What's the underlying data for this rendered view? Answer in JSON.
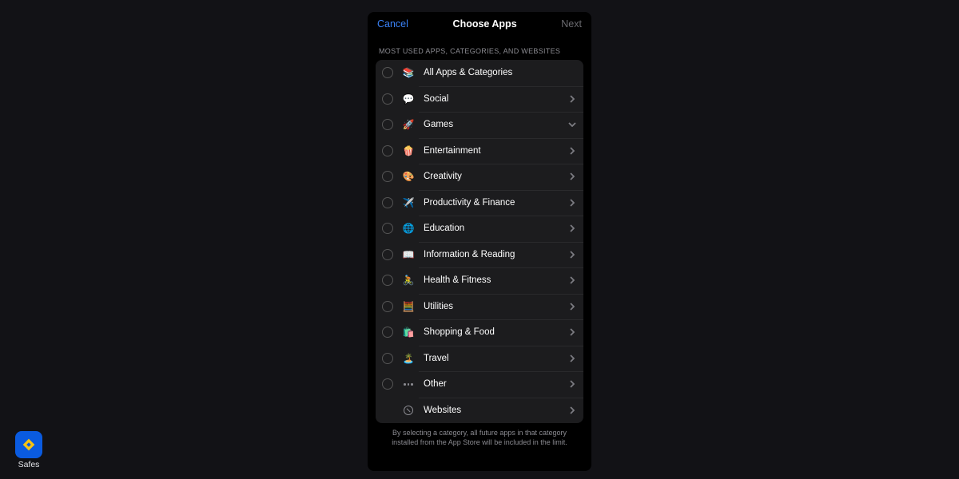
{
  "navbar": {
    "cancel": "Cancel",
    "title": "Choose Apps",
    "next": "Next"
  },
  "section_header": "MOST USED APPS, CATEGORIES, AND WEBSITES",
  "categories": [
    {
      "id": "all",
      "label": "All Apps & Categories",
      "icon": "📚",
      "chevron": "none"
    },
    {
      "id": "social",
      "label": "Social",
      "icon": "💬",
      "chevron": "right"
    },
    {
      "id": "games",
      "label": "Games",
      "icon": "🚀",
      "chevron": "down"
    },
    {
      "id": "entertainment",
      "label": "Entertainment",
      "icon": "🍿",
      "chevron": "right"
    },
    {
      "id": "creativity",
      "label": "Creativity",
      "icon": "🎨",
      "chevron": "right"
    },
    {
      "id": "productivity",
      "label": "Productivity & Finance",
      "icon": "✈️",
      "chevron": "right"
    },
    {
      "id": "education",
      "label": "Education",
      "icon": "🌐",
      "chevron": "right"
    },
    {
      "id": "reading",
      "label": "Information & Reading",
      "icon": "📖",
      "chevron": "right"
    },
    {
      "id": "health",
      "label": "Health & Fitness",
      "icon": "🚴",
      "chevron": "right"
    },
    {
      "id": "utilities",
      "label": "Utilities",
      "icon": "🧮",
      "chevron": "right"
    },
    {
      "id": "shopping",
      "label": "Shopping & Food",
      "icon": "🛍️",
      "chevron": "right"
    },
    {
      "id": "travel",
      "label": "Travel",
      "icon": "🏝️",
      "chevron": "right"
    },
    {
      "id": "other",
      "label": "Other",
      "icon": "ellipsis",
      "chevron": "right"
    },
    {
      "id": "websites",
      "label": "Websites",
      "icon": "compass",
      "chevron": "right",
      "no_radio": true
    }
  ],
  "footnote": "By selecting a category, all future apps in that category installed from the App Store will be included in the limit.",
  "badge": {
    "label": "Safes"
  }
}
